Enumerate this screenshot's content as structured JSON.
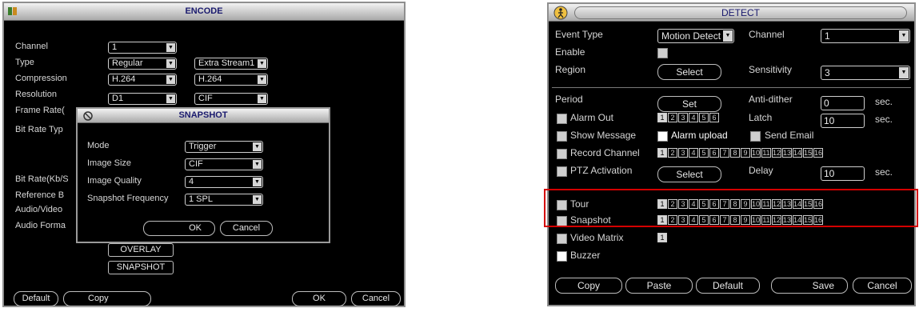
{
  "encode": {
    "title": "ENCODE",
    "labels": {
      "channel": "Channel",
      "type": "Type",
      "compression": "Compression",
      "resolution": "Resolution",
      "frame_rate": "Frame Rate(",
      "bit_rate_type": "Bit Rate Typ",
      "bit_rate": "Bit Rate(Kb/S",
      "reference": "Reference B",
      "audio_video": "Audio/Video",
      "audio_format": "Audio Forma"
    },
    "values": {
      "channel": "1",
      "type_main": "Regular",
      "type_extra": "Extra Stream1",
      "compression_main": "H.264",
      "compression_extra": "H.264",
      "resolution_main": "D1",
      "resolution_extra": "CIF"
    },
    "buttons": {
      "overlay": "OVERLAY",
      "snapshot": "SNAPSHOT",
      "default": "Default",
      "copy": "Copy",
      "ok": "OK",
      "cancel": "Cancel"
    }
  },
  "snapshot": {
    "title": "SNAPSHOT",
    "labels": {
      "mode": "Mode",
      "image_size": "Image Size",
      "image_quality": "Image Quality",
      "frequency": "Snapshot Frequency"
    },
    "values": {
      "mode": "Trigger",
      "image_size": "CIF",
      "image_quality": "4",
      "frequency": "1 SPL"
    },
    "buttons": {
      "ok": "OK",
      "cancel": "Cancel"
    }
  },
  "detect": {
    "title": "DETECT",
    "labels": {
      "event_type": "Event Type",
      "channel": "Channel",
      "enable": "Enable",
      "region": "Region",
      "sensitivity": "Sensitivity",
      "period": "Period",
      "anti_dither": "Anti-dither",
      "sec": "sec.",
      "alarm_out": "Alarm Out",
      "latch": "Latch",
      "show_message": "Show Message",
      "alarm_upload": "Alarm upload",
      "send_email": "Send Email",
      "record_channel": "Record Channel",
      "ptz_activation": "PTZ Activation",
      "delay": "Delay",
      "tour": "Tour",
      "snapshot": "Snapshot",
      "video_matrix": "Video Matrix",
      "buzzer": "Buzzer"
    },
    "values": {
      "event_type": "Motion Detect",
      "channel": "1",
      "sensitivity": "3",
      "anti_dither": "0",
      "latch": "10",
      "delay": "10"
    },
    "alarm_out_channels": [
      "1",
      "2",
      "3",
      "4",
      "5",
      "6"
    ],
    "channels16": [
      "1",
      "2",
      "3",
      "4",
      "5",
      "6",
      "7",
      "8",
      "9",
      "10",
      "11",
      "12",
      "13",
      "14",
      "15",
      "16"
    ],
    "video_matrix_channels": [
      "1"
    ],
    "buttons": {
      "region_select": "Select",
      "period_set": "Set",
      "ptz_select": "Select",
      "copy": "Copy",
      "paste": "Paste",
      "default": "Default",
      "save": "Save",
      "cancel": "Cancel"
    },
    "highlight_color": "#d40000"
  }
}
